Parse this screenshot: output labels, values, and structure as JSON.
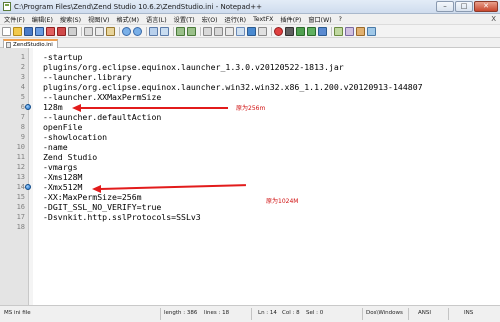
{
  "window": {
    "title": "C:\\Program Files\\Zend\\Zend Studio 10.6.2\\ZendStudio.ini - Notepad++",
    "minimize": "–",
    "maximize": "□",
    "close": "✕"
  },
  "menu": {
    "items": [
      "文件(F)",
      "编辑(E)",
      "搜索(S)",
      "视图(V)",
      "格式(M)",
      "语言(L)",
      "设置(T)",
      "宏(O)",
      "运行(R)",
      "TextFX",
      "插件(P)",
      "窗口(W)",
      "?"
    ],
    "close_glyph": "X"
  },
  "tab": {
    "label": "ZendStudio.ini"
  },
  "editor": {
    "lines": [
      {
        "num": "1",
        "text": "-startup",
        "bookmark": false
      },
      {
        "num": "2",
        "text": "plugins/org.eclipse.equinox.launcher_1.3.0.v20120522-1813.jar",
        "bookmark": false
      },
      {
        "num": "3",
        "text": "--launcher.library",
        "bookmark": false
      },
      {
        "num": "4",
        "text": "plugins/org.eclipse.equinox.launcher.win32.win32.x86_1.1.200.v20120913-144807",
        "bookmark": false
      },
      {
        "num": "5",
        "text": "--launcher.XXMaxPermSize",
        "bookmark": false
      },
      {
        "num": "6",
        "text": "128m",
        "bookmark": true
      },
      {
        "num": "7",
        "text": "--launcher.defaultAction",
        "bookmark": false
      },
      {
        "num": "8",
        "text": "openFile",
        "bookmark": false
      },
      {
        "num": "9",
        "text": "-showlocation",
        "bookmark": false
      },
      {
        "num": "10",
        "text": "-name",
        "bookmark": false
      },
      {
        "num": "11",
        "text": "Zend Studio",
        "bookmark": false
      },
      {
        "num": "12",
        "text": "-vmargs",
        "bookmark": false
      },
      {
        "num": "13",
        "text": "-Xms128M",
        "bookmark": false
      },
      {
        "num": "14",
        "text": "-Xmx512M",
        "bookmark": true
      },
      {
        "num": "15",
        "text": "-XX:MaxPermSize=256m",
        "bookmark": false
      },
      {
        "num": "16",
        "text": "-DGIT_SSL_NO_VERIFY=true",
        "bookmark": false
      },
      {
        "num": "17",
        "text": "-Dsvnkit.http.sslProtocols=SSLv3",
        "bookmark": false
      },
      {
        "num": "18",
        "text": "",
        "bookmark": false
      }
    ]
  },
  "annotations": {
    "note_line6": "原为256m",
    "note_line14": "原为1024M",
    "arrow_color": "#e21b1b"
  },
  "status": {
    "file_type": "MS ini file",
    "length": "length : 386",
    "lines": "lines : 18",
    "ln": "Ln : 14",
    "col": "Col : 8",
    "sel": "Sel : 0",
    "eol": "Dos\\Windows",
    "encoding": "ANSI",
    "mode": "INS"
  },
  "colors": {
    "title_gradient_top": "#e3ecf7",
    "bookmark_blue": "#1d6fc4",
    "tab_accent": "#f0a050"
  }
}
